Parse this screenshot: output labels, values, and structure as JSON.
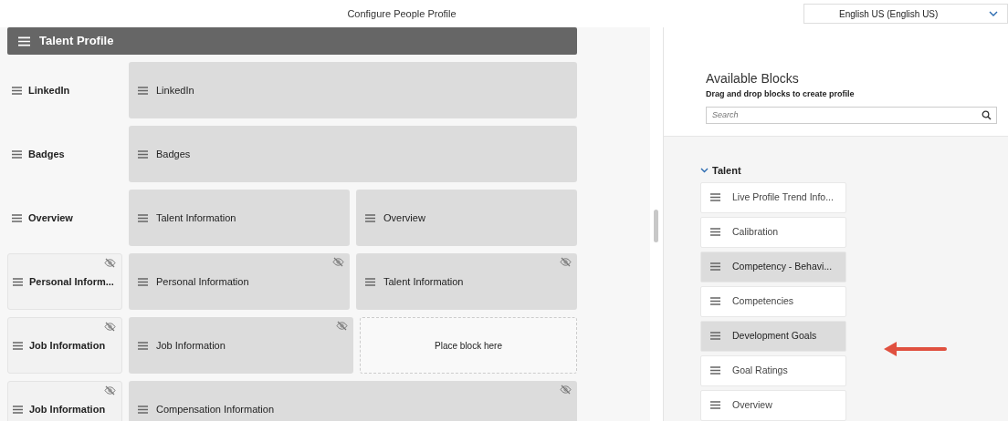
{
  "title": "Configure People Profile",
  "language": {
    "value": "English US (English US)"
  },
  "profile": {
    "title": "Talent Profile",
    "rows": [
      {
        "label": "LinkedIn",
        "hidden": false,
        "blocks": [
          {
            "kind": "block",
            "text": "LinkedIn",
            "hidden": false
          }
        ]
      },
      {
        "label": "Badges",
        "hidden": false,
        "blocks": [
          {
            "kind": "block",
            "text": "Badges",
            "hidden": false
          }
        ]
      },
      {
        "label": "Overview",
        "hidden": false,
        "blocks": [
          {
            "kind": "block",
            "text": "Talent Information",
            "hidden": false
          },
          {
            "kind": "block",
            "text": "Overview",
            "hidden": false
          }
        ]
      },
      {
        "label": "Personal Inform...",
        "hidden": true,
        "blocks": [
          {
            "kind": "block",
            "text": "Personal Information",
            "hidden": true
          },
          {
            "kind": "block",
            "text": "Talent Information",
            "hidden": true
          }
        ]
      },
      {
        "label": "Job Information",
        "hidden": true,
        "blocks": [
          {
            "kind": "block",
            "text": "Job Information",
            "hidden": true
          },
          {
            "kind": "placeholder",
            "text": "Place block here"
          }
        ]
      },
      {
        "label": "Job Information",
        "hidden": true,
        "blocks": [
          {
            "kind": "block",
            "text": "Compensation Information",
            "hidden": true
          }
        ]
      }
    ]
  },
  "available": {
    "title": "Available Blocks",
    "subtitle": "Drag and drop blocks to create profile",
    "search": {
      "placeholder": "Search"
    },
    "group": {
      "label": "Talent",
      "expanded": true,
      "items": [
        {
          "label": "Live Profile Trend Info...",
          "selected": false
        },
        {
          "label": "Calibration",
          "selected": false
        },
        {
          "label": "Competency - Behavi...",
          "selected": true
        },
        {
          "label": "Competencies",
          "selected": false
        },
        {
          "label": "Development Goals",
          "selected": true
        },
        {
          "label": "Goal Ratings",
          "selected": false
        },
        {
          "label": "Overview",
          "selected": false
        }
      ]
    }
  }
}
